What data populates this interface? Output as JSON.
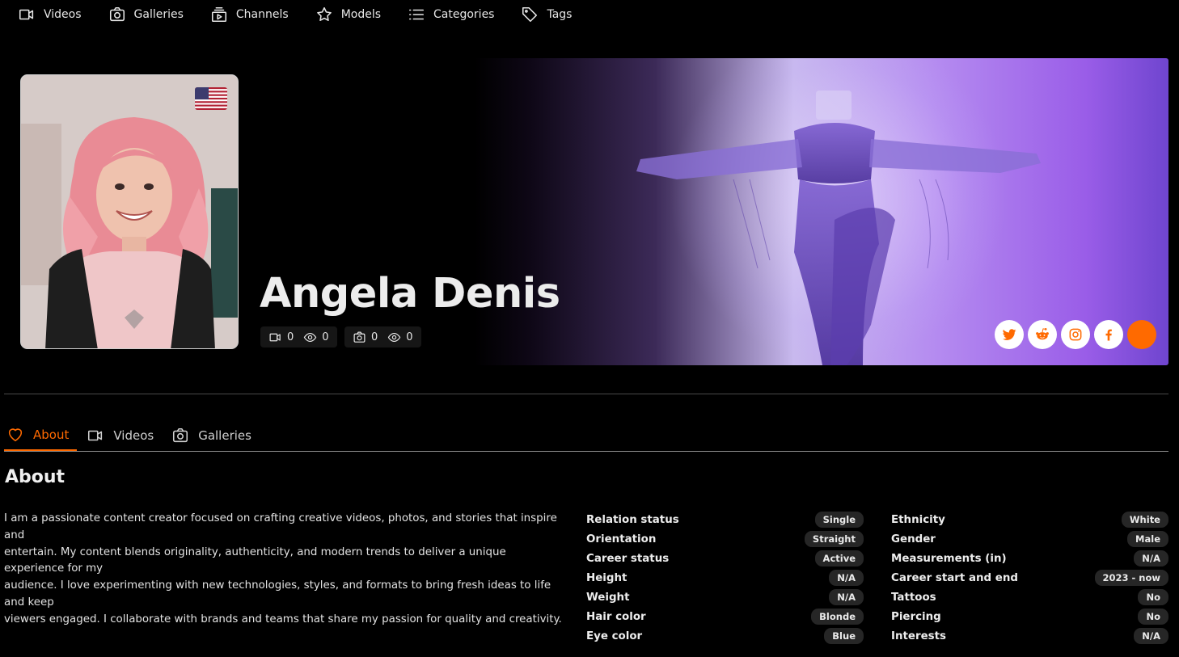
{
  "nav": {
    "items": [
      {
        "label": "Videos",
        "icon": "video-camera-icon"
      },
      {
        "label": "Galleries",
        "icon": "camera-icon"
      },
      {
        "label": "Channels",
        "icon": "channels-icon"
      },
      {
        "label": "Models",
        "icon": "star-icon"
      },
      {
        "label": "Categories",
        "icon": "list-icon"
      },
      {
        "label": "Tags",
        "icon": "tag-icon"
      }
    ]
  },
  "profile": {
    "name": "Angela Denis",
    "country_flag": "us-flag-icon",
    "video_stats": {
      "videos": "0",
      "views": "0"
    },
    "gallery_stats": {
      "galleries": "0",
      "views": "0"
    }
  },
  "socials": [
    {
      "name": "twitter-icon",
      "color": "#ff6a00"
    },
    {
      "name": "reddit-icon",
      "color": "#ff6a00"
    },
    {
      "name": "instagram-icon",
      "color": "#ff6a00"
    },
    {
      "name": "facebook-icon",
      "color": "#ff6a00"
    },
    {
      "name": "orange-circle-icon",
      "color": "#ff6a00"
    }
  ],
  "tabs": [
    {
      "label": "About",
      "icon": "heart-icon",
      "active": true
    },
    {
      "label": "Videos",
      "icon": "video-camera-icon",
      "active": false
    },
    {
      "label": "Galleries",
      "icon": "camera-icon",
      "active": false
    }
  ],
  "about": {
    "title": "About",
    "bio_lines": [
      "I am a passionate content creator focused on crafting creative videos, photos, and stories that inspire and",
      "entertain. My content blends originality, authenticity, and modern trends to deliver a unique experience for my",
      "audience. I love experimenting with new technologies, styles, and formats to bring fresh ideas to life and keep",
      "viewers engaged. I collaborate with brands and teams that share my passion for quality and creativity."
    ],
    "info_left": [
      {
        "label": "Relation status",
        "value": "Single"
      },
      {
        "label": "Orientation",
        "value": "Straight"
      },
      {
        "label": "Career status",
        "value": "Active"
      },
      {
        "label": "Height",
        "value": "N/A"
      },
      {
        "label": "Weight",
        "value": "N/A"
      },
      {
        "label": "Hair color",
        "value": "Blonde"
      },
      {
        "label": "Eye color",
        "value": "Blue"
      }
    ],
    "info_right": [
      {
        "label": "Ethnicity",
        "value": "White"
      },
      {
        "label": "Gender",
        "value": "Male"
      },
      {
        "label": "Measurements (in)",
        "value": "N/A"
      },
      {
        "label": "Career start and end",
        "value": "2023 - now"
      },
      {
        "label": "Tattoos",
        "value": "No"
      },
      {
        "label": "Piercing",
        "value": "No"
      },
      {
        "label": "Interests",
        "value": "N/A"
      }
    ]
  },
  "colors": {
    "accent": "#ff6a00",
    "background": "#000000",
    "pill": "#262626"
  }
}
